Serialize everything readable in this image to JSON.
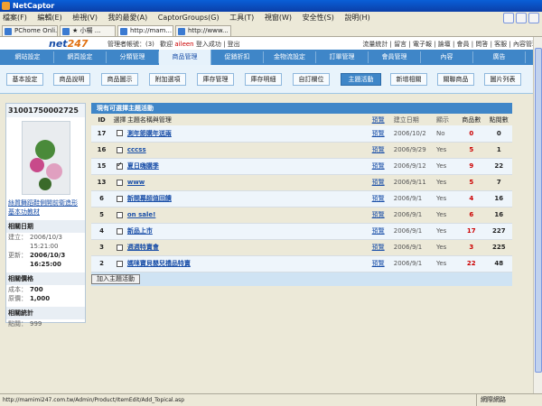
{
  "window": {
    "title": "NetCaptor"
  },
  "menubar": {
    "items": [
      "檔案(F)",
      "編輯(E)",
      "檢視(V)",
      "我的最愛(A)",
      "CaptorGroups(G)",
      "工具(T)",
      "視窗(W)",
      "安全性(S)",
      "說明(H)"
    ]
  },
  "tabs": [
    {
      "label": "PChome Onli...",
      "active": false
    },
    {
      "label": "★ 小楊 ...",
      "active": false
    },
    {
      "label": "http://mam...",
      "active": true
    },
    {
      "label": "http://www...",
      "active": false
    }
  ],
  "header": {
    "logo_main": "net",
    "logo_num": "247",
    "top_links_a": "管理者帳號：(3)",
    "top_links_b": "歡迎",
    "user": "aileen",
    "top_links_c": "登入成功 | 登出",
    "right_links": "流量統計 | 留言 | 電子報 | 論壇 | 會員 | 問答 | 客服 | 內容管理"
  },
  "main_nav": [
    {
      "label": "網站設定",
      "active": false
    },
    {
      "label": "網頁設定",
      "active": false
    },
    {
      "label": "分類管理",
      "active": false
    },
    {
      "label": "商品管理",
      "active": true
    },
    {
      "label": "促銷折扣",
      "active": false
    },
    {
      "label": "金物流設定",
      "active": false
    },
    {
      "label": "訂單管理",
      "active": false
    },
    {
      "label": "會員管理",
      "active": false
    },
    {
      "label": "內容",
      "active": false
    },
    {
      "label": "廣告",
      "active": false
    }
  ],
  "sub_nav": [
    {
      "label": "基本設定",
      "active": false
    },
    {
      "label": "商品說明",
      "active": false
    },
    {
      "label": "商品圖示",
      "active": false
    },
    {
      "label": "附加選項",
      "active": false
    },
    {
      "label": "庫存管理",
      "active": false
    },
    {
      "label": "庫存明細",
      "active": false
    },
    {
      "label": "自訂欄位",
      "active": false
    },
    {
      "label": "主題活動",
      "active": true
    },
    {
      "label": "新增相關",
      "active": false
    },
    {
      "label": "關聯商品",
      "active": false
    },
    {
      "label": "圖片列表",
      "active": false
    }
  ],
  "product": {
    "code": "31001750002725",
    "name": "絲質舞蹈鞋側開前衛造形基本功教材",
    "sections": {
      "dates_title": "相關日期",
      "settings_title": "相關價格",
      "stats_title": "相關統計"
    },
    "created_label": "建立：",
    "created_date": "2006/10/3",
    "created_time": "15:21:00",
    "updated_label": "更新：",
    "updated_date": "2006/10/3",
    "updated_time": "16:25:00",
    "cost_label": "成本：",
    "cost_value": "700",
    "price_label": "原價：",
    "price_value": "1,000",
    "clicks_label": "點閱：",
    "clicks_value": "999"
  },
  "table": {
    "title": "現有可選擇主題活動",
    "headers": {
      "id": "ID",
      "select": "選擇",
      "name": "主題名稱與管理",
      "preview": "預覽",
      "created": "建立日期",
      "show": "顯示",
      "count": "商品數",
      "clicks": "點閱數"
    },
    "rows": [
      {
        "id": "17",
        "checked": false,
        "name": "測年節購年送兩",
        "preview": "預覽",
        "date": "2006/10/2",
        "show": "No",
        "count": "0",
        "clicks": "0"
      },
      {
        "id": "16",
        "checked": false,
        "name": "cccss",
        "preview": "預覽",
        "date": "2006/9/29",
        "show": "Yes",
        "count": "5",
        "clicks": "1"
      },
      {
        "id": "15",
        "checked": true,
        "name": "夏日嗨購季",
        "preview": "預覽",
        "date": "2006/9/12",
        "show": "Yes",
        "count": "9",
        "clicks": "22"
      },
      {
        "id": "13",
        "checked": false,
        "name": "www",
        "preview": "預覽",
        "date": "2006/9/11",
        "show": "Yes",
        "count": "5",
        "clicks": "7"
      },
      {
        "id": "6",
        "checked": false,
        "name": "新開幕超值回饋",
        "preview": "預覽",
        "date": "2006/9/1",
        "show": "Yes",
        "count": "4",
        "clicks": "16"
      },
      {
        "id": "5",
        "checked": false,
        "name": "on sale!",
        "preview": "預覽",
        "date": "2006/9/1",
        "show": "Yes",
        "count": "6",
        "clicks": "16"
      },
      {
        "id": "4",
        "checked": false,
        "name": "新品上市",
        "preview": "預覽",
        "date": "2006/9/1",
        "show": "Yes",
        "count": "17",
        "clicks": "227"
      },
      {
        "id": "3",
        "checked": false,
        "name": "週週特賣會",
        "preview": "預覽",
        "date": "2006/9/1",
        "show": "Yes",
        "count": "3",
        "clicks": "225"
      },
      {
        "id": "2",
        "checked": false,
        "name": "媽咪寶貝嬰兒禮品特賣",
        "preview": "預覽",
        "date": "2006/9/1",
        "show": "Yes",
        "count": "22",
        "clicks": "48"
      }
    ],
    "add_button": "加入主題活動"
  },
  "status": {
    "url": "http://mamimi247.com.tw/Admin/Product/ItemEdit/Add_Topical.asp",
    "zone": "網際網路"
  }
}
